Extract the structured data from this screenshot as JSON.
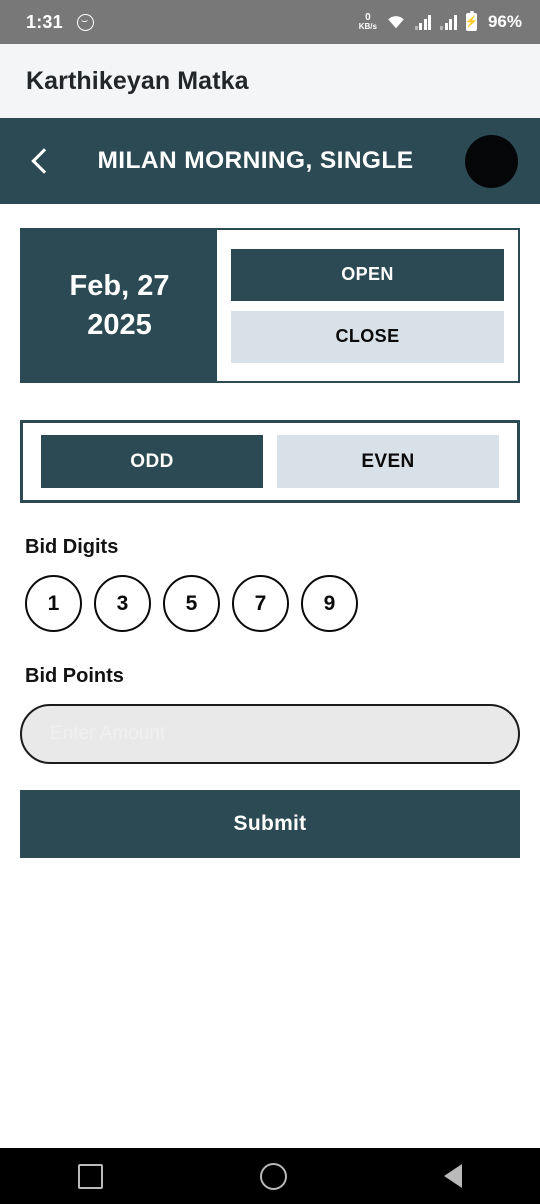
{
  "status_bar": {
    "time": "1:31",
    "face_icon": "smiley-face-icon",
    "net_speed_value": "0",
    "net_speed_unit": "KB/s",
    "wifi_icon": "wifi-icon",
    "signal_icon_1": "cellular-signal-icon",
    "signal_icon_2": "cellular-signal-icon",
    "battery_icon": "battery-charging-icon",
    "battery_percent": "96%",
    "background_color": "#787878"
  },
  "app_bar": {
    "title": "Karthikeyan Matka",
    "background_color": "#f4f5f6"
  },
  "nav_bar": {
    "back_icon": "chevron-left-icon",
    "title": "MILAN MORNING, SINGLE",
    "avatar_label": "",
    "background_color": "#2c4a54",
    "avatar_color": "#050608"
  },
  "session_card": {
    "date_line1": "Feb, 27",
    "date_line2": "2025",
    "buttons": [
      {
        "label": "OPEN",
        "selected": true
      },
      {
        "label": "CLOSE",
        "selected": false
      }
    ]
  },
  "parity_card": {
    "buttons": [
      {
        "label": "ODD",
        "selected": true
      },
      {
        "label": "EVEN",
        "selected": false
      }
    ]
  },
  "bid_digits": {
    "label": "Bid Digits",
    "digits": [
      "1",
      "3",
      "5",
      "7",
      "9"
    ]
  },
  "bid_points": {
    "label": "Bid Points",
    "placeholder": "Enter Amount",
    "value": ""
  },
  "submit": {
    "label": "Submit"
  },
  "system_nav": {
    "recents_icon": "square-recents-icon",
    "home_icon": "circle-home-icon",
    "back_icon": "triangle-back-icon"
  },
  "theme": {
    "primary": "#2c4a54",
    "light_button": "#d9e1e8",
    "page_background": "#ffffff"
  }
}
